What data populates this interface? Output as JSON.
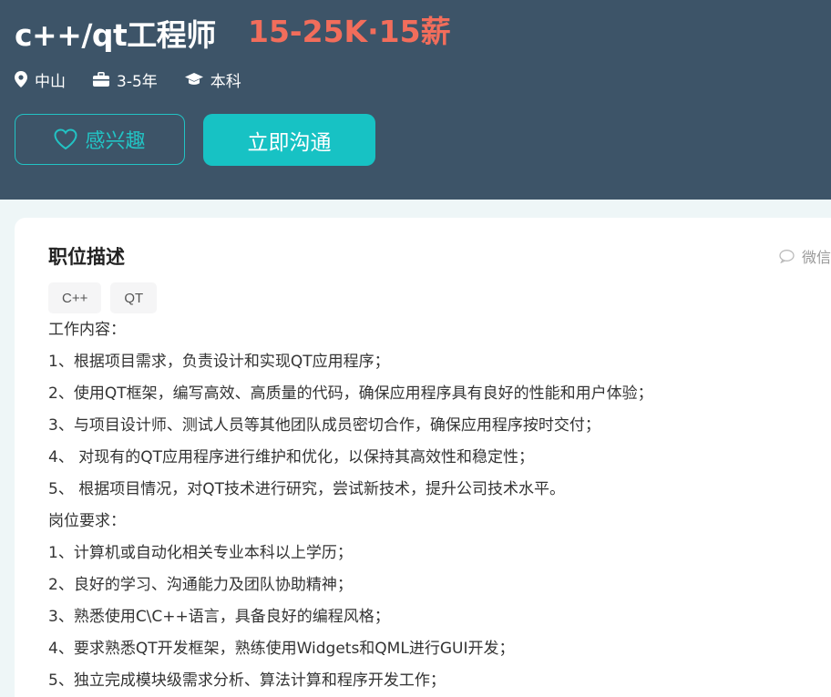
{
  "header": {
    "title": "c++/qt工程师",
    "salary": "15-25K·15薪",
    "meta": {
      "location": "中山",
      "experience": "3-5年",
      "education": "本科"
    },
    "interest_label": "感兴趣",
    "chat_label": "立即沟通"
  },
  "detail": {
    "section_title": "职位描述",
    "wechat_label": "微信",
    "tags": [
      "C++",
      "QT"
    ],
    "lines": [
      "工作内容：",
      "1、根据项目需求，负责设计和实现QT应用程序；",
      "2、使用QT框架，编写高效、高质量的代码，确保应用程序具有良好的性能和用户体验；",
      "3、与项目设计师、测试人员等其他团队成员密切合作，确保应用程序按时交付；",
      "4、 对现有的QT应用程序进行维护和优化，以保持其高效性和稳定性；",
      "5、 根据项目情况，对QT技术进行研究，尝试新技术，提升公司技术水平。",
      "岗位要求：",
      "1、计算机或自动化相关专业本科以上学历；",
      "2、良好的学习、沟通能力及团队协助精神；",
      "3、熟悉使用C\\C++语言，具备良好的编程风格；",
      "4、要求熟悉QT开发框架，熟练使用Widgets和QML进行GUI开发；",
      "5、独立完成模块级需求分析、算法计算和程序开发工作；"
    ]
  },
  "colors": {
    "header_bg": "#3d5468",
    "accent": "#17c2c4",
    "salary": "#f26d5b"
  }
}
